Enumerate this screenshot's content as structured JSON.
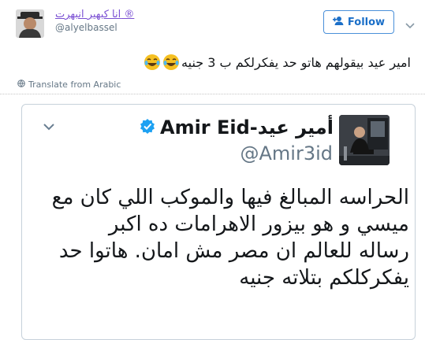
{
  "top_tweet": {
    "display_name": "انا كبهير انبهرت ®",
    "handle": "@alyelbassel",
    "follow_label": "Follow",
    "text": "امير عيد بيقولهم هاتو حد يفكرلكم ب 3 جنيه",
    "translate_label": "Translate from Arabic",
    "icons": [
      "avatar",
      "add-user-icon",
      "chevron-down-icon",
      "laughing-emoji",
      "globe-icon"
    ]
  },
  "quoted_tweet": {
    "display_name": "Amir Eid-أمير عيد",
    "handle": "@Amir3id",
    "body_lines": [
      "الحراسه المبالغ فيها والموكب اللي كان مع",
      "ميسي و هو بيزور الاهرامات ده اكبر",
      "رساله للعالم ان مصر مش امان. هاتوا حد",
      "يفكركلكم بتلاته جنيه"
    ],
    "verified": true,
    "icons": [
      "verified-badge-icon",
      "chevron-down-icon",
      "avatar"
    ]
  },
  "colors": {
    "link_purple": "#7a4fd3",
    "twitter_blue": "#1da1f2",
    "follow_text": "#1b6fc8",
    "muted": "#657786"
  }
}
